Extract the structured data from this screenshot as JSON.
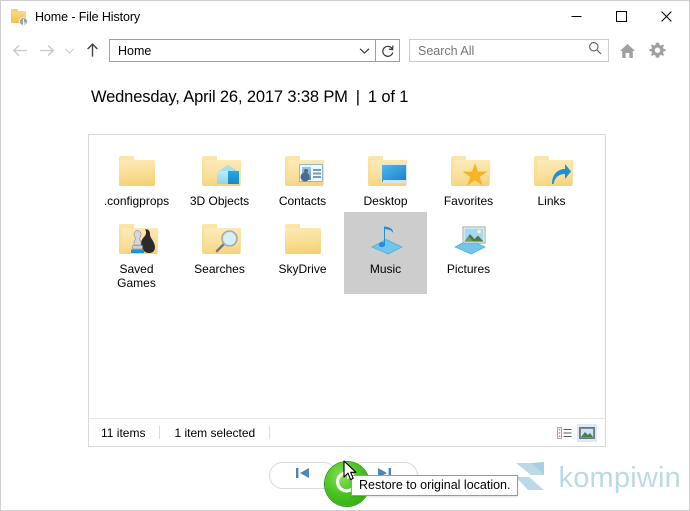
{
  "window": {
    "title": "Home - File History",
    "title_icon": "folder-history-icon",
    "controls": {
      "minimize": "minimize-icon",
      "maximize": "maximize-icon",
      "close": "close-icon"
    }
  },
  "toolbar": {
    "back": "back-arrow-icon",
    "forward": "forward-arrow-icon",
    "recent": "chevron-down-icon",
    "up": "up-arrow-icon",
    "address_value": "Home",
    "address_chevron": "chevron-down-icon",
    "refresh": "refresh-icon",
    "search_placeholder": "Search All",
    "search_value": "",
    "search_icon": "search-icon",
    "home_icon": "home-icon",
    "settings_icon": "gear-icon"
  },
  "header": {
    "date": "Wednesday, April 26, 2017 3:38 PM",
    "separator": "|",
    "page_count": "1 of 1"
  },
  "items": [
    {
      "label": ".configprops",
      "icon": "folder-icon",
      "selected": false
    },
    {
      "label": "3D Objects",
      "icon": "folder-3d-objects-icon",
      "selected": false
    },
    {
      "label": "Contacts",
      "icon": "folder-contacts-icon",
      "selected": false
    },
    {
      "label": "Desktop",
      "icon": "folder-desktop-icon",
      "selected": false
    },
    {
      "label": "Favorites",
      "icon": "folder-favorites-icon",
      "selected": false
    },
    {
      "label": "Links",
      "icon": "folder-links-icon",
      "selected": false
    },
    {
      "label": "Saved Games",
      "icon": "folder-saved-games-icon",
      "selected": false
    },
    {
      "label": "Searches",
      "icon": "folder-searches-icon",
      "selected": false
    },
    {
      "label": "SkyDrive",
      "icon": "folder-icon",
      "selected": false
    },
    {
      "label": "Music",
      "icon": "music-library-icon",
      "selected": true
    },
    {
      "label": "Pictures",
      "icon": "pictures-library-icon",
      "selected": false
    }
  ],
  "status": {
    "item_count": "11 items",
    "selection": "1 item selected",
    "details_view_icon": "details-view-icon",
    "large_icons_view_icon": "large-icons-view-icon"
  },
  "bottom": {
    "previous_label": "previous-version-icon",
    "next_label": "next-version-icon",
    "restore_label": "restore-icon",
    "tooltip": "Restore to original location."
  },
  "watermark": {
    "text": "kompiwin",
    "logo": "kompiwin-logo-icon"
  },
  "colors": {
    "accent_blue": "#0078d7",
    "restore_green": "#46c21e",
    "folder_yellow": "#f6d88c",
    "selection_gray": "#cdcdcd",
    "watermark_blue": "#bcd9e8"
  }
}
